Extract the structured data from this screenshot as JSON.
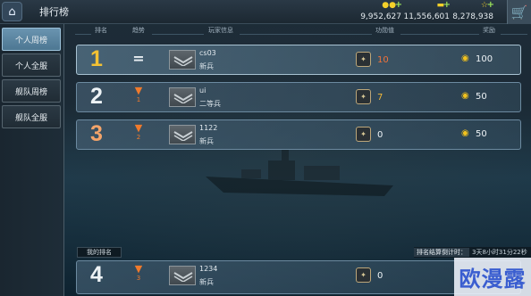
{
  "header": {
    "back_icon": "back-arrow-icon",
    "title": "排行榜",
    "resources": [
      {
        "icon": "gold-coins-icon",
        "value": "9,952,627"
      },
      {
        "icon": "gold-bars-icon",
        "value": "11,556,601"
      },
      {
        "icon": "star-icon",
        "value": "8,278,938"
      }
    ],
    "shop_icon": "shopping-cart-icon"
  },
  "sidebar": {
    "tabs": [
      {
        "label": "个人周榜",
        "active": true
      },
      {
        "label": "个人全服",
        "active": false
      },
      {
        "label": "舰队周榜",
        "active": false
      },
      {
        "label": "舰队全服",
        "active": false
      }
    ]
  },
  "columns": {
    "rank": "排名",
    "change": "趋势",
    "player": "玩家信息",
    "medals": "功勋值",
    "reward": "奖励"
  },
  "rows": [
    {
      "rank": "1",
      "rank_color": "#f4c233",
      "trend": "same",
      "trend_symbol": "=",
      "change": "",
      "name": "cs03",
      "title": "新兵",
      "score": "10",
      "score_color": "#f0723a",
      "reward": "100"
    },
    {
      "rank": "2",
      "rank_color": "#eef3f6",
      "trend": "down",
      "trend_symbol": "▼",
      "change": "1",
      "name": "ui",
      "title": "二等兵",
      "score": "7",
      "score_color": "#f0b83a",
      "reward": "50"
    },
    {
      "rank": "3",
      "rank_color": "#f4a46a",
      "trend": "down",
      "trend_symbol": "▼",
      "change": "2",
      "name": "1122",
      "title": "新兵",
      "score": "0",
      "score_color": "#eef3f6",
      "reward": "50"
    }
  ],
  "my_rank": {
    "label": "我的排名",
    "rank": "4",
    "trend_symbol": "▼",
    "change": "3",
    "name": "1234",
    "title": "新兵",
    "score": "0"
  },
  "countdown": {
    "label": "排名结算倒计时：",
    "time": "3天8小时31分22秒"
  },
  "watermark": "欧漫露",
  "colors": {
    "active_tab": "#5a86a4",
    "trend_down": "#f07a2c",
    "coin": "#f2c21d"
  }
}
